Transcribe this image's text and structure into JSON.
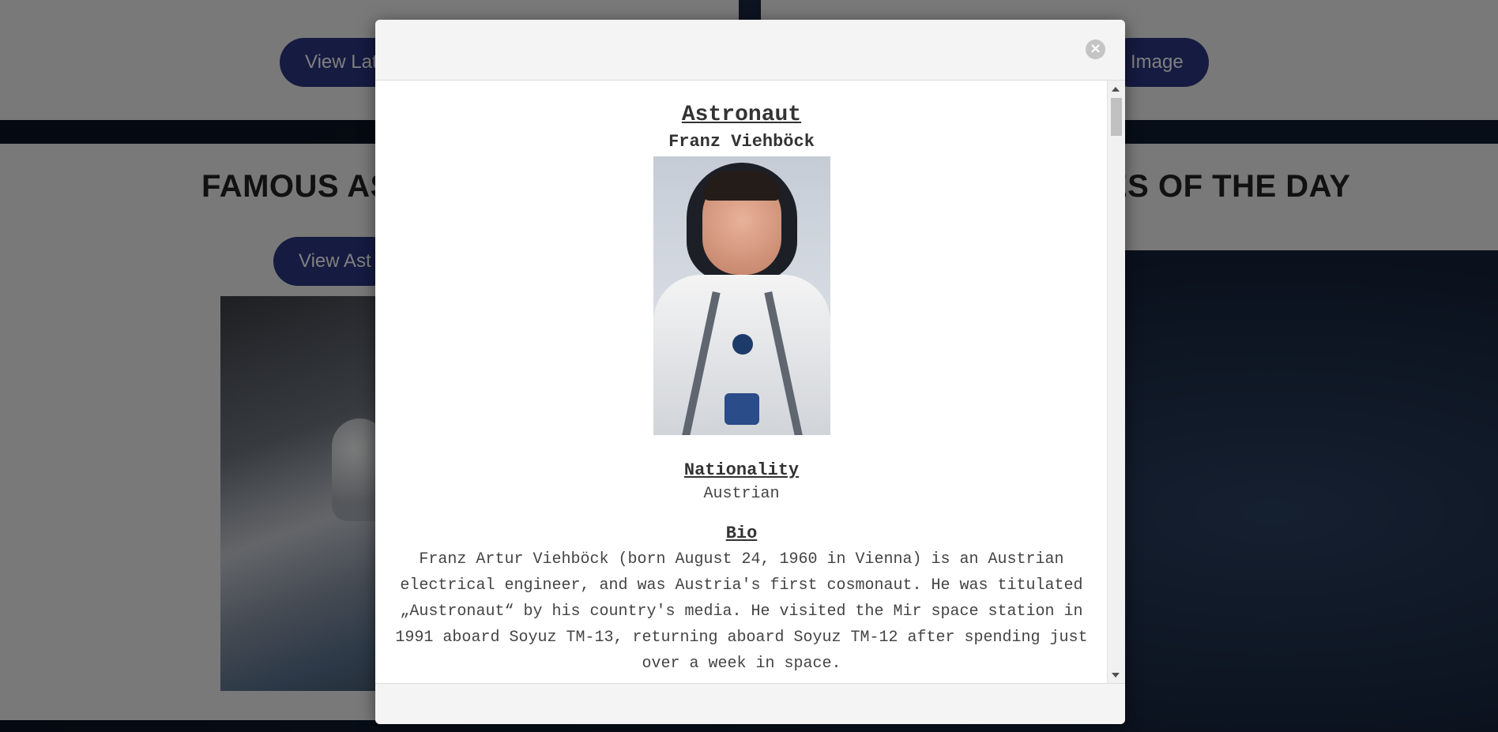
{
  "background": {
    "top_left_button": "View Latest",
    "top_right_button": "Image",
    "section_heading_left": "FAMOUS AS",
    "section_heading_right": "ES OF THE DAY",
    "astronaut_button": "View Ast"
  },
  "modal": {
    "close_glyph": "×",
    "title": "Astronaut",
    "name": "Franz Viehböck",
    "nationality_label": "Nationality",
    "nationality_value": "Austrian",
    "bio_label": "Bio",
    "bio_text": "Franz Artur Viehböck (born August 24, 1960 in Vienna) is an Austrian electrical engineer, and was Austria's first cosmonaut. He was titulated „Austronaut“ by his country's media. He visited the Mir space station in 1991 aboard Soyuz TM-13, returning aboard Soyuz TM-12 after spending just over a week in space."
  },
  "colors": {
    "pill_blue": "#2b3782",
    "overlay": "rgba(0,0,0,0.5)"
  }
}
